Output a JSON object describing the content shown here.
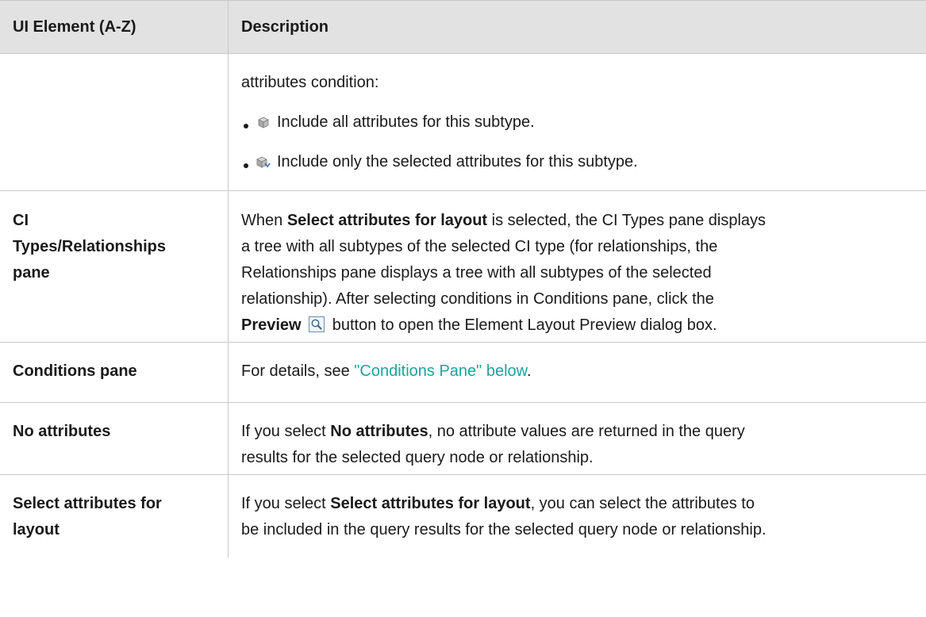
{
  "header": {
    "col1": "UI Element (A-Z)",
    "col2": "Description"
  },
  "rows": [
    {
      "element": "",
      "intro": "attributes condition:",
      "bullets": [
        {
          "icon": "cube-icon",
          "text": "Include all attributes for this subtype."
        },
        {
          "icon": "cube-filtered-icon",
          "text": "Include only the selected attributes for this subtype."
        }
      ]
    },
    {
      "element_lines": [
        "CI",
        "Types/Relationships",
        "pane"
      ],
      "p1_before": "When ",
      "p1_bold": "Select attributes for layout",
      "p1_after": " is selected, the CI Types pane displays",
      "line2": "a tree with all subtypes of the selected CI type (for relationships, the",
      "line3": "Relationships pane displays a tree with all subtypes of the selected",
      "line4": "relationship). After selecting conditions in Conditions pane, click the",
      "line5_bold": "Preview",
      "line5_after": " button to open the Element Layout Preview dialog box.",
      "preview_icon": "magnifier-icon"
    },
    {
      "element": "Conditions pane",
      "text_before": "For details, see ",
      "link": "\"Conditions Pane\" below",
      "text_after": "."
    },
    {
      "element": "No attributes",
      "l1_before": "If you select ",
      "l1_bold": "No attributes",
      "l1_after": ", no attribute values are returned in the query",
      "l2": "results for the selected query node or relationship."
    },
    {
      "element_lines": [
        "Select attributes for",
        "layout"
      ],
      "l1_before": "If you select ",
      "l1_bold": "Select attributes for layout",
      "l1_after": ", you can select the attributes to",
      "l2": "be included in the query results for the selected query node or relationship."
    }
  ],
  "colors": {
    "header_bg": "#e2e2e2",
    "border": "#c9c9c9",
    "link": "#1aa59a"
  }
}
